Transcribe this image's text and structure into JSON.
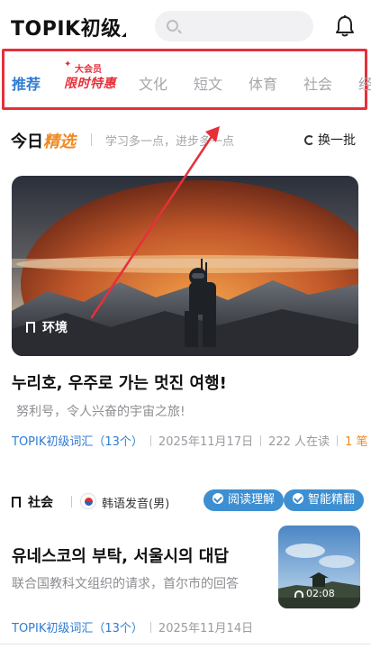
{
  "header": {
    "title": "TOPIK初级",
    "search_placeholder": "",
    "bell_icon": "bell-icon"
  },
  "tabs": {
    "items": [
      {
        "label": "推荐",
        "active": true
      },
      {
        "label": "文化",
        "active": false
      },
      {
        "label": "短文",
        "active": false
      },
      {
        "label": "体育",
        "active": false
      },
      {
        "label": "社会",
        "active": false
      },
      {
        "label": "经",
        "active": false
      }
    ],
    "promo": {
      "top": "大会员",
      "main": "限时特惠"
    }
  },
  "today": {
    "title_a": "今日",
    "title_b": "精选",
    "subtitle": "学习多一点，进步多一点",
    "refresh_label": "换一批"
  },
  "hero": {
    "tag": "环境"
  },
  "article1": {
    "title": "누리호, 우주로 가는 멋진 여행!",
    "subtitle": "努利号，令人兴奋的宇宙之旅!",
    "vocab": "TOPIK初级词汇（13个）",
    "date": "2025年11月17日",
    "readers": "222 人在读",
    "notes": "1 笔"
  },
  "article2": {
    "category": "社会",
    "voice": "韩语发音(男)",
    "pill1": "阅读理解",
    "pill2": "智能精翻",
    "title": "유네스코의 부탁, 서울시의 대답",
    "subtitle": "联合国教科文组织的请求，首尔市的回答",
    "duration": "02:08",
    "vocab": "TOPIK初级词汇（13个）",
    "date": "2025年11月14日"
  },
  "colors": {
    "accent_blue": "#2f7cd3",
    "pill_blue": "#3d8fd1",
    "annotation_red": "#e5303a",
    "accent_orange": "#f08a24"
  }
}
